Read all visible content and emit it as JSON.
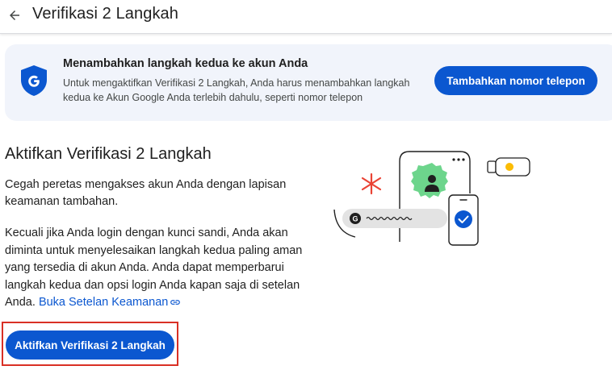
{
  "header": {
    "title": "Verifikasi 2 Langkah"
  },
  "banner": {
    "title": "Menambahkan langkah kedua ke akun Anda",
    "description": "Untuk mengaktifkan Verifikasi 2 Langkah, Anda harus menambahkan langkah kedua ke Akun Google Anda terlebih dahulu, seperti nomor telepon",
    "button_label": "Tambahkan nomor telepon",
    "icon": "google-shield-icon"
  },
  "main": {
    "title": "Aktifkan Verifikasi 2 Langkah",
    "paragraph1": "Cegah peretas mengakses akun Anda dengan lapisan keamanan tambahan.",
    "paragraph2": "Kecuali jika Anda login dengan kunci sandi, Anda akan diminta untuk menyelesaikan langkah kedua paling aman yang tersedia di akun Anda. Anda dapat memperbarui langkah kedua dan opsi login Anda kapan saja di setelan Anda.",
    "security_link": "Buka Setelan Keamanan",
    "enable_button": "Aktifkan Verifikasi 2 Langkah"
  },
  "colors": {
    "accent": "#0b57d0",
    "banner_bg": "#f1f4fb",
    "highlight": "#d93025",
    "green": "#6dd58c",
    "yellow": "#fbbc04",
    "red": "#ea4335"
  }
}
